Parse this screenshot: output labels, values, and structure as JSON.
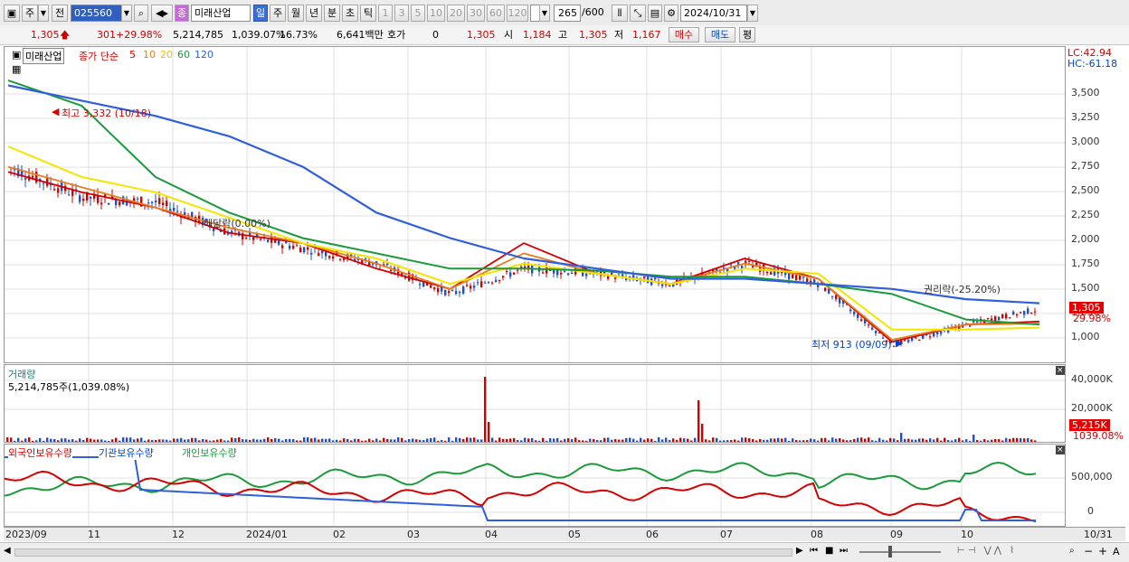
{
  "toolbar": {
    "mode_main": "주",
    "mode_prev": "전",
    "code": "025560",
    "stock_name": "미래산업",
    "periods": [
      "일",
      "주",
      "월",
      "년",
      "분",
      "초",
      "틱"
    ],
    "selected_period": "일",
    "intervals": [
      "1",
      "3",
      "5",
      "10",
      "20",
      "30",
      "60",
      "120"
    ],
    "count": "265",
    "count_total": "/600",
    "date": "2024/10/31",
    "name_badge": "종"
  },
  "quote": {
    "price": "1,305",
    "change": "301",
    "change_rate": "+29.98%",
    "volume": "5,214,785",
    "volume_rate": "1,039.07%",
    "turnover": "16.73%",
    "amount": "6,641백만",
    "hoga_label": "호가",
    "hoga_value": "0",
    "hoga_price": "1,305",
    "open_label": "시",
    "open": "1,184",
    "high_label": "고",
    "high": "1,305",
    "low_label": "저",
    "low": "1,167",
    "buy": "매수",
    "sell": "매도",
    "avg": "평"
  },
  "legend": {
    "name": "미래산업",
    "close_label": "종가 단순",
    "ma": [
      "5",
      "10",
      "20",
      "60",
      "120"
    ],
    "ma_colors": [
      "#d40000",
      "#e87d1e",
      "#f2e600",
      "#1a9a3a",
      "#2f5fdc"
    ]
  },
  "annotations": {
    "high": "최고 3,332 (10/18)",
    "low": "최저 913 (09/09)",
    "dividend": "배당락(0.00%)",
    "rights": "권리락(-25.20%)"
  },
  "price_axis": {
    "lc": "LC:42.94",
    "hc": "HC:-61.18",
    "ticks": [
      "3,500",
      "3,250",
      "3,000",
      "2,750",
      "2,500",
      "2,250",
      "2,000",
      "1,750",
      "1,500",
      "1,250",
      "1,000"
    ],
    "current": "1,305",
    "current_rate": "29.98%"
  },
  "volume_panel": {
    "title": "거래량",
    "info": "5,214,785주(1,039.08%)",
    "ticks": [
      "40,000K",
      "20,000K"
    ],
    "current": "5,215K",
    "current_rate": "1039.08%"
  },
  "holding_panel": {
    "series": [
      "외국인보유수량",
      "기관보유수량",
      "개인보유수량"
    ],
    "ticks": [
      "500,000",
      "0"
    ]
  },
  "dates": [
    "2023/09",
    "11",
    "12",
    "2024/01",
    "02",
    "03",
    "04",
    "05",
    "06",
    "07",
    "08",
    "09",
    "10",
    "10/31"
  ],
  "chart_data": {
    "type": "line",
    "title": "",
    "xlabel": "",
    "ylabel": "",
    "x": [
      "2023/09",
      "11",
      "12",
      "2024/01",
      "02",
      "03",
      "04",
      "05",
      "06",
      "07",
      "08",
      "09",
      "10",
      "10/31"
    ],
    "ylim": [
      850,
      3700
    ],
    "series": [
      {
        "name": "종가",
        "values": [
          2700,
          2400,
          2350,
          2050,
          1900,
          1750,
          1450,
          1700,
          1650,
          1550,
          1750,
          1550,
          950,
          1150,
          1305
        ]
      },
      {
        "name": "5",
        "values": [
          2650,
          2450,
          2300,
          2050,
          1950,
          1700,
          1500,
          1950,
          1650,
          1550,
          1800,
          1600,
          980,
          1150,
          1180
        ]
      },
      {
        "name": "10",
        "values": [
          2700,
          2500,
          2300,
          2100,
          1950,
          1750,
          1500,
          1850,
          1650,
          1550,
          1750,
          1600,
          1000,
          1150,
          1160
        ]
      },
      {
        "name": "20",
        "values": [
          2900,
          2600,
          2450,
          2200,
          1950,
          1800,
          1550,
          1750,
          1650,
          1550,
          1700,
          1650,
          1100,
          1100,
          1120
        ]
      },
      {
        "name": "60",
        "values": [
          3550,
          3300,
          2600,
          2250,
          2000,
          1850,
          1700,
          1700,
          1680,
          1620,
          1620,
          1550,
          1450,
          1200,
          1150
        ]
      },
      {
        "name": "120",
        "values": [
          3500,
          3350,
          3200,
          3000,
          2700,
          2250,
          2000,
          1800,
          1700,
          1600,
          1600,
          1550,
          1500,
          1400,
          1360
        ]
      }
    ]
  }
}
